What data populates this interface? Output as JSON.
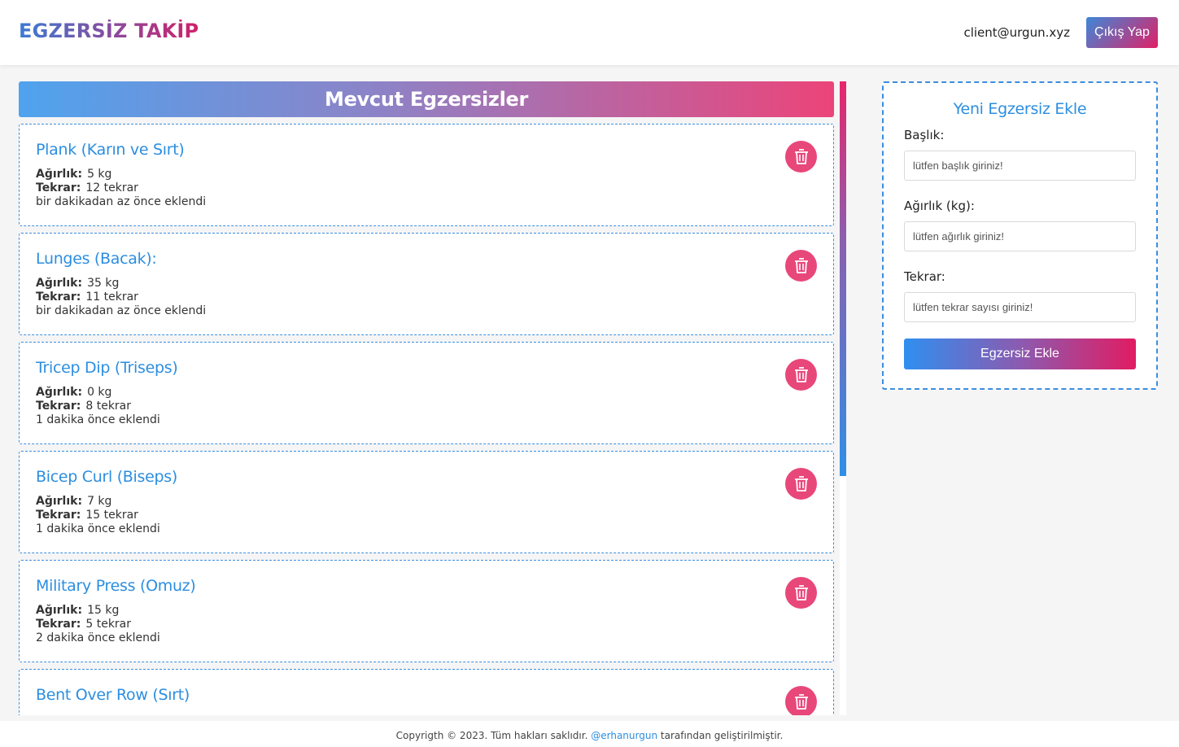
{
  "header": {
    "logo": "EGZERSİZ TAKİP",
    "user_email": "client@urgun.xyz",
    "logout_label": "Çıkış Yap"
  },
  "list": {
    "title": "Mevcut Egzersizler",
    "weight_label": "Ağırlık:",
    "reps_label": "Tekrar:",
    "items": [
      {
        "title": "Plank (Karın ve Sırt)",
        "weight": "5 kg",
        "reps": "12 tekrar",
        "added": "bir dakikadan az önce eklendi"
      },
      {
        "title": "Lunges (Bacak):",
        "weight": "35 kg",
        "reps": "11 tekrar",
        "added": "bir dakikadan az önce eklendi"
      },
      {
        "title": "Tricep Dip (Triseps)",
        "weight": "0 kg",
        "reps": "8 tekrar",
        "added": "1 dakika önce eklendi"
      },
      {
        "title": "Bicep Curl (Biseps)",
        "weight": "7 kg",
        "reps": "15 tekrar",
        "added": "1 dakika önce eklendi"
      },
      {
        "title": "Military Press (Omuz)",
        "weight": "15 kg",
        "reps": "5 tekrar",
        "added": "2 dakika önce eklendi"
      },
      {
        "title": "Bent Over Row (Sırt)",
        "weight": "",
        "reps": "",
        "added": ""
      }
    ]
  },
  "form": {
    "title": "Yeni Egzersiz Ekle",
    "title_label": "Başlık:",
    "title_placeholder": "lütfen başlık giriniz!",
    "weight_label": "Ağırlık (kg):",
    "weight_placeholder": "lütfen ağırlık giriniz!",
    "reps_label": "Tekrar:",
    "reps_placeholder": "lütfen tekrar sayısı giriniz!",
    "submit_label": "Egzersiz Ekle"
  },
  "footer": {
    "text_before": "Copyrigth © 2023. Tüm hakları saklıdır.",
    "link": "@erhanurgun",
    "text_after": "tarafından geliştirilmiştir."
  },
  "colors": {
    "accent_blue": "#2c8ee0",
    "accent_pink": "#e8477a"
  },
  "icons": {
    "delete": "trash-icon"
  }
}
